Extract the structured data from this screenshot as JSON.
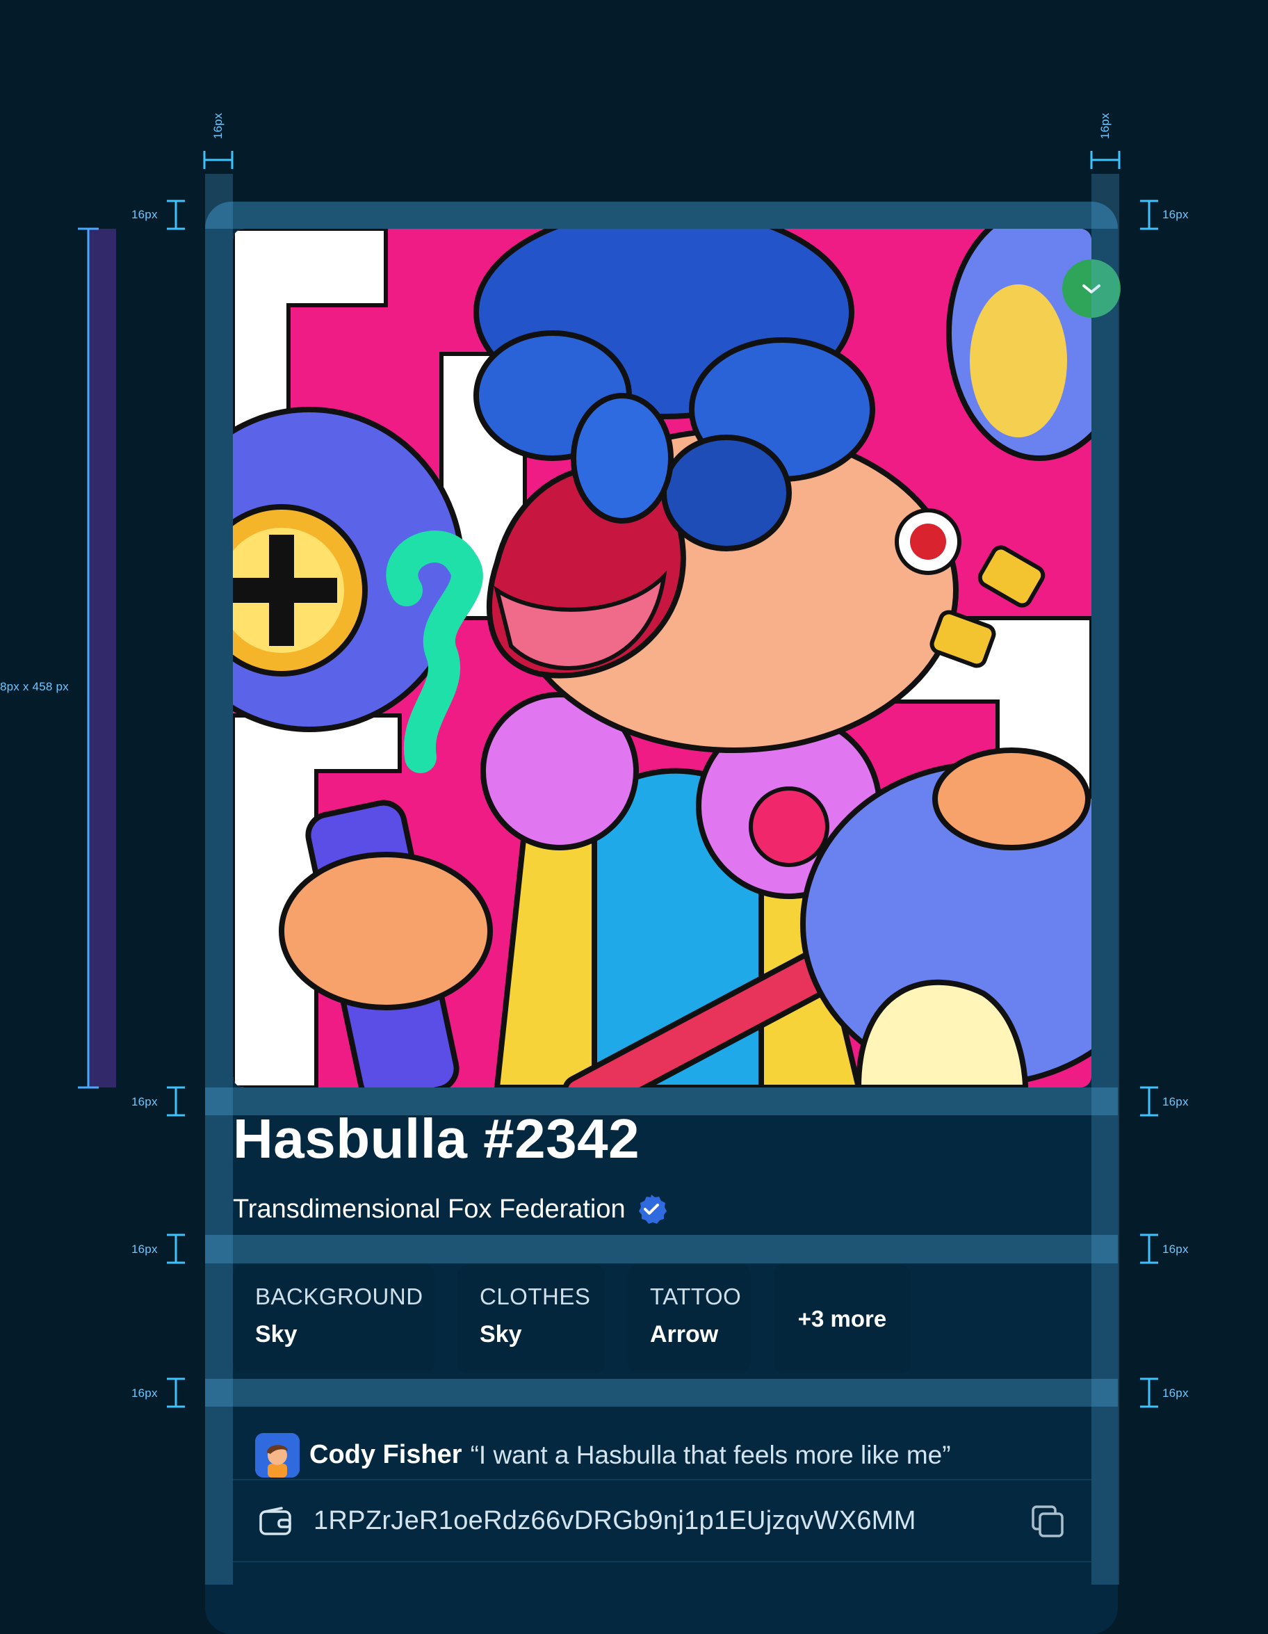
{
  "nft": {
    "title": "Hasbulla #2342",
    "collection": "Transdimensional Fox Federation"
  },
  "traits": [
    {
      "type": "BACKGROUND",
      "value": "Sky"
    },
    {
      "type": "CLOTHES",
      "value": "Sky"
    },
    {
      "type": "TATTOO",
      "value": "Arrow"
    }
  ],
  "traits_more": "+3 more",
  "quote": {
    "author": "Cody Fisher",
    "text": "“I want a Hasbulla that feels more like me”"
  },
  "wallet": {
    "address": "1RPZrJeR1oeRdz66vDRGb9nj1p1EUjzqvWX6MM"
  },
  "annotations": {
    "spacing": "16px",
    "image_size": "8px x 458 px"
  },
  "colors": {
    "background": "#041b29",
    "card": "#04283f",
    "overlay": "#58b2e6",
    "verified": "#2f6bde",
    "status_dot": "#2fa55a"
  },
  "icons": [
    "verified-badge-icon",
    "check-icon",
    "wallet-icon",
    "copy-icon"
  ]
}
